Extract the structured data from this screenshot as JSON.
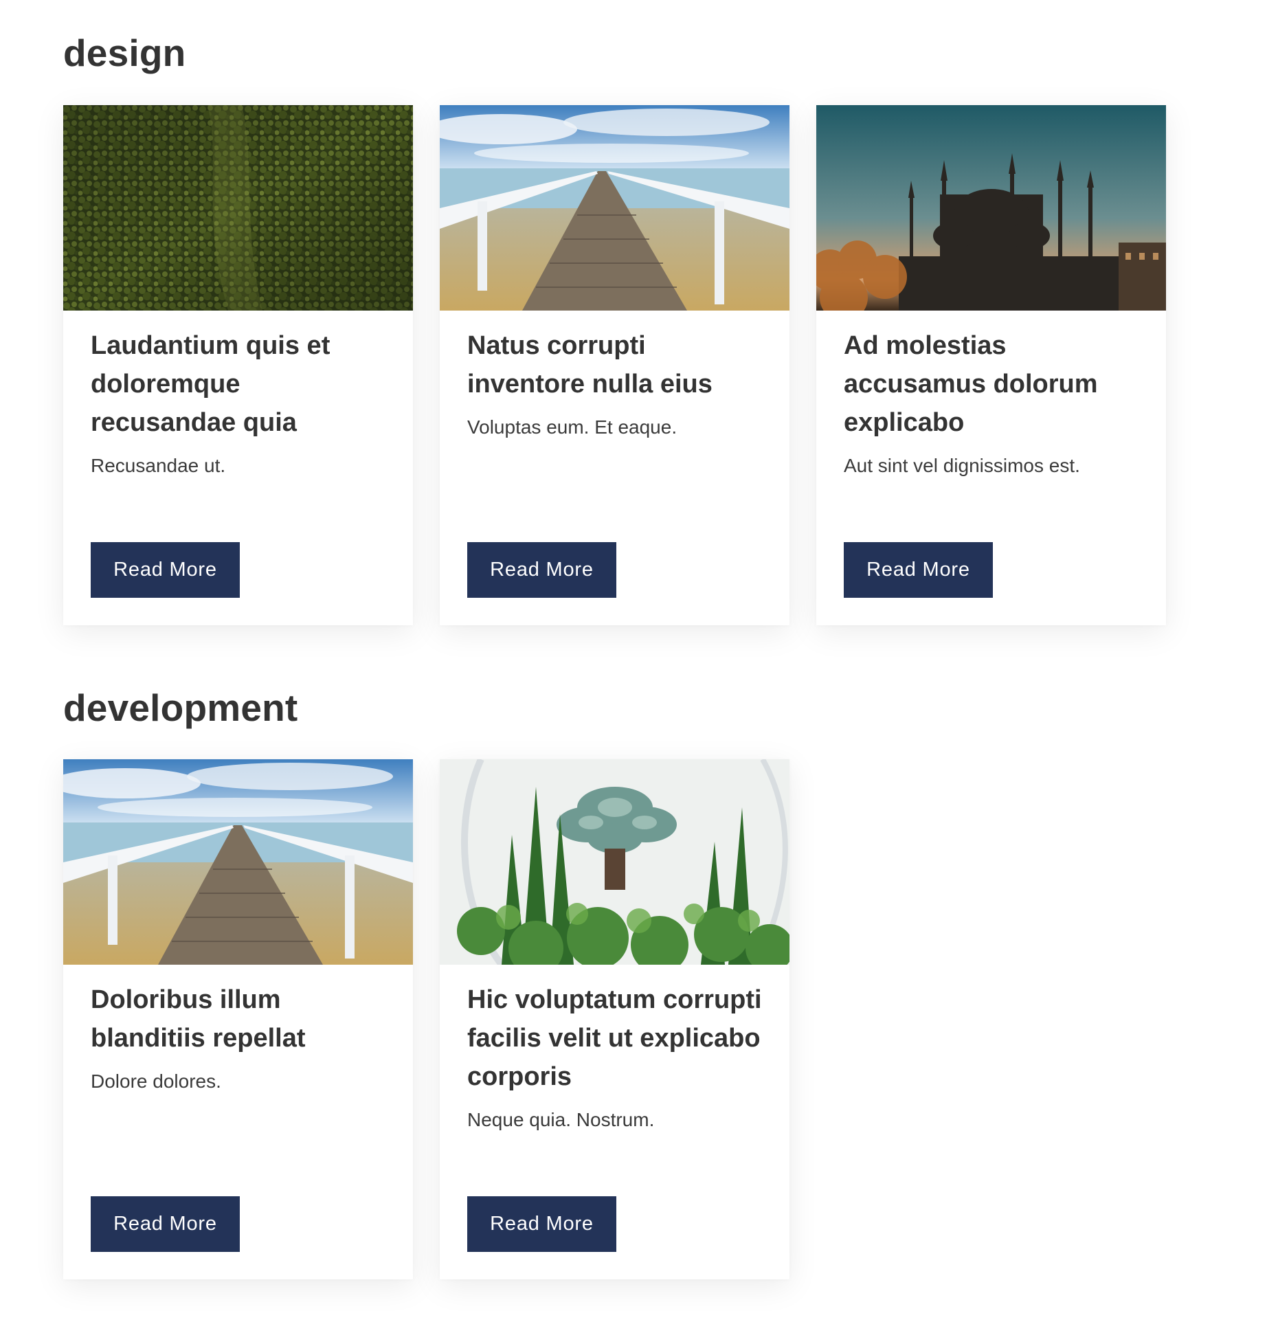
{
  "sections": [
    {
      "title": "design",
      "cards": [
        {
          "image": "aerial-forest-image",
          "title": "Laudantium quis et doloremque recusandae quia",
          "excerpt": "Recusandae ut.",
          "button": "Read More"
        },
        {
          "image": "beach-pier-image",
          "title": "Natus corrupti inventore nulla eius",
          "excerpt": "Voluptas eum. Et eaque.",
          "button": "Read More"
        },
        {
          "image": "mosque-skyline-image",
          "title": "Ad molestias accusamus dolorum explicabo",
          "excerpt": "Aut sint vel dignissimos est.",
          "button": "Read More"
        }
      ]
    },
    {
      "title": "development",
      "cards": [
        {
          "image": "beach-pier-image",
          "title": "Doloribus illum blanditiis repellat",
          "excerpt": "Dolore dolores.",
          "button": "Read More"
        },
        {
          "image": "succulent-terrarium-image",
          "title": "Hic voluptatum corrupti facilis velit ut explicabo corporis",
          "excerpt": "Neque quia. Nostrum.",
          "button": "Read More"
        }
      ]
    }
  ],
  "colors": {
    "button_bg": "#233358",
    "button_text": "#ffffff",
    "heading": "#333333",
    "page_bg": "#ffffff"
  }
}
